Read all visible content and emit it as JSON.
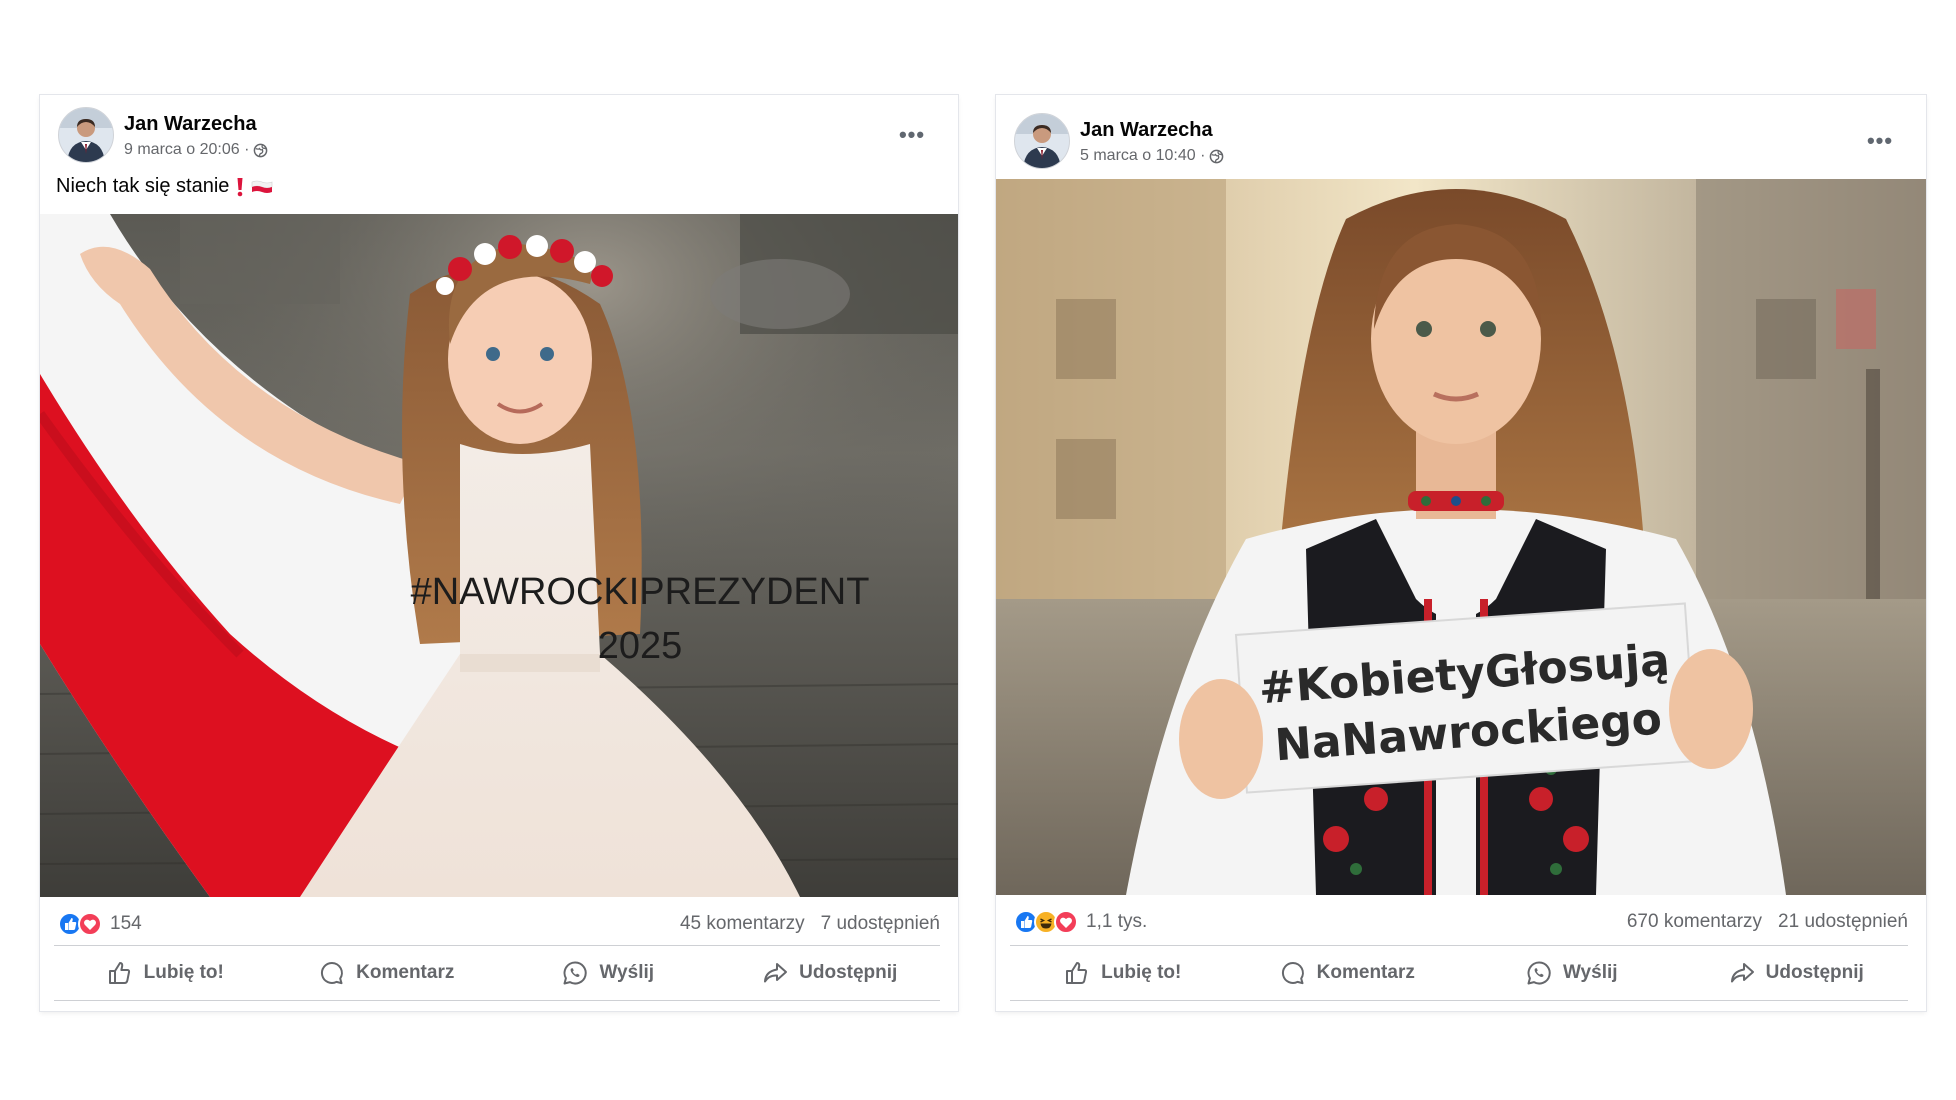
{
  "posts": [
    {
      "author": "Jan Warzecha",
      "date": "9 marca o 20:06 ·",
      "caption": "Niech tak się stanie",
      "image_overlay": {
        "line1": "#NAWROCKIPREZYDENT",
        "line2": "2025"
      },
      "reactions": {
        "count": "154",
        "icons": [
          "like-reaction",
          "love-reaction"
        ]
      },
      "comments": "45 komentarzy",
      "shares": "7 udostępnień",
      "actions": {
        "like": "Lubię to!",
        "comment": "Komentarz",
        "send": "Wyślij",
        "share": "Udostępnij"
      }
    },
    {
      "author": "Jan Warzecha",
      "date": "5 marca o 10:40 ·",
      "image_overlay": {
        "line1": "#KobietyGłosują",
        "line2": "NaNawrockiego"
      },
      "reactions": {
        "count": "1,1 tys.",
        "icons": [
          "like-reaction",
          "haha-reaction",
          "love-reaction"
        ]
      },
      "comments": "670 komentarzy",
      "shares": "21 udostępnień",
      "actions": {
        "like": "Lubię to!",
        "comment": "Komentarz",
        "send": "Wyślij",
        "share": "Udostępnij"
      }
    }
  ],
  "colors": {
    "like_blue": "#1877f2",
    "love_red": "#f33e58",
    "haha_yellow": "#f7b125",
    "flag_red": "#dc143c",
    "secondary_text": "#65676b"
  }
}
